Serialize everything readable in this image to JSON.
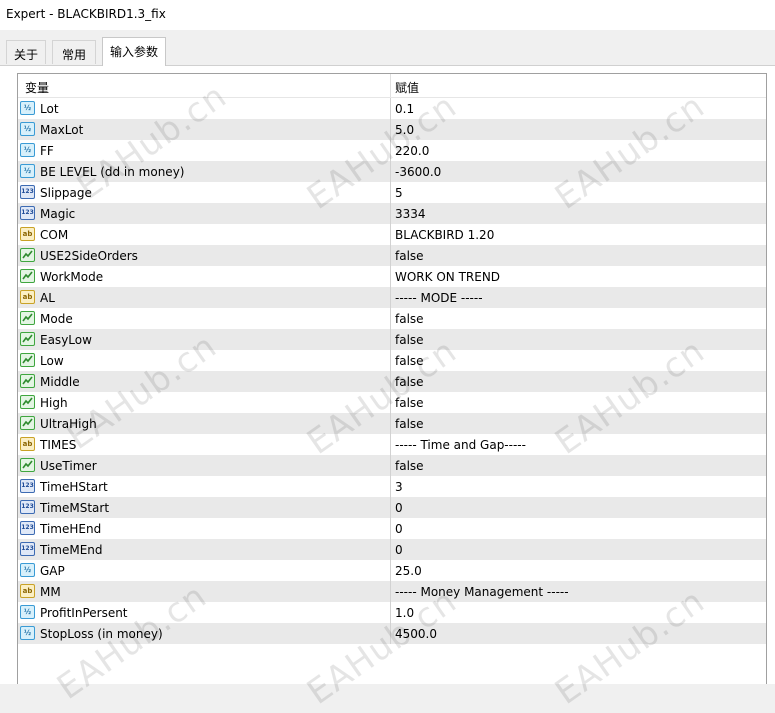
{
  "window": {
    "title": "Expert - BLACKBIRD1.3_fix"
  },
  "tabs": [
    {
      "label": "关于"
    },
    {
      "label": "常用"
    },
    {
      "label": "输入参数",
      "active": true
    }
  ],
  "table": {
    "headers": {
      "variable": "变量",
      "value": "赋值"
    },
    "rows": [
      {
        "icon": "double-icon",
        "name": "Lot",
        "value": "0.1"
      },
      {
        "icon": "double-icon",
        "name": "MaxLot",
        "value": "5.0"
      },
      {
        "icon": "double-icon",
        "name": "FF",
        "value": "220.0"
      },
      {
        "icon": "double-icon",
        "name": "BE LEVEL (dd in money)",
        "value": "-3600.0"
      },
      {
        "icon": "integer-icon",
        "name": "Slippage",
        "value": "5"
      },
      {
        "icon": "integer-icon",
        "name": "Magic",
        "value": "3334"
      },
      {
        "icon": "string-icon",
        "name": "COM",
        "value": "BLACKBIRD 1.20"
      },
      {
        "icon": "bool-icon",
        "name": "USE2SideOrders",
        "value": "false"
      },
      {
        "icon": "bool-icon",
        "name": "WorkMode",
        "value": "WORK ON TREND"
      },
      {
        "icon": "string-icon",
        "name": "AL",
        "value": "----- MODE -----"
      },
      {
        "icon": "bool-icon",
        "name": "Mode",
        "value": "false"
      },
      {
        "icon": "bool-icon",
        "name": "EasyLow",
        "value": "false"
      },
      {
        "icon": "bool-icon",
        "name": "Low",
        "value": "false"
      },
      {
        "icon": "bool-icon",
        "name": "Middle",
        "value": "false"
      },
      {
        "icon": "bool-icon",
        "name": "High",
        "value": "false"
      },
      {
        "icon": "bool-icon",
        "name": "UltraHigh",
        "value": "false"
      },
      {
        "icon": "string-icon",
        "name": "TIMES",
        "value": "----- Time and Gap-----"
      },
      {
        "icon": "bool-icon",
        "name": "UseTimer",
        "value": "false"
      },
      {
        "icon": "integer-icon",
        "name": "TimeHStart",
        "value": "3"
      },
      {
        "icon": "integer-icon",
        "name": "TimeMStart",
        "value": "0"
      },
      {
        "icon": "integer-icon",
        "name": "TimeHEnd",
        "value": "0"
      },
      {
        "icon": "integer-icon",
        "name": "TimeMEnd",
        "value": "0"
      },
      {
        "icon": "double-icon",
        "name": "GAP",
        "value": "25.0"
      },
      {
        "icon": "string-icon",
        "name": "MM",
        "value": "----- Money Management -----"
      },
      {
        "icon": "double-icon",
        "name": "ProfitInPersent",
        "value": "1.0"
      },
      {
        "icon": "double-icon",
        "name": "StopLoss (in money)",
        "value": "4500.0"
      }
    ]
  },
  "icon_labels": {
    "double": "½",
    "integer": "123",
    "string": "ab"
  },
  "watermark": "EAHub.cn",
  "colors": {
    "row_alt": "#e9e9e9",
    "double_icon": "#3a9bd5",
    "integer_icon": "#3d6bb3",
    "string_icon": "#c9a227",
    "bool_icon": "#3fa63f"
  }
}
